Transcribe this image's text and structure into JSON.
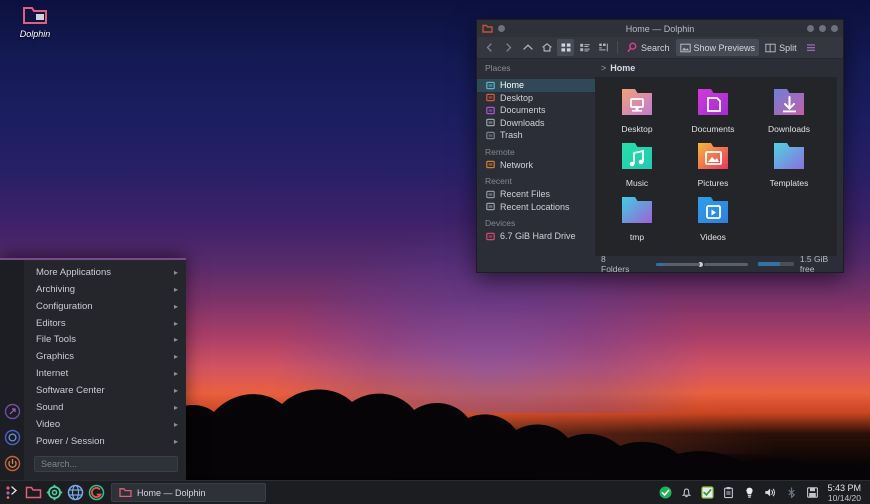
{
  "desktop": {
    "icon": {
      "label": "Dolphin",
      "icon": "folder-icon"
    }
  },
  "dolphin": {
    "titlebar": {
      "title": "Home — Dolphin",
      "app_icon": "folder-icon",
      "menu_dot": "window-menu-dot",
      "buttons": [
        "minimize-button",
        "maximize-button",
        "close-button"
      ]
    },
    "toolbar": {
      "back": "back-arrow-icon",
      "forward": "forward-arrow-icon",
      "up": "up-arrow-icon",
      "home": "home-icon",
      "view_icons": "view-icons-icon",
      "view_compact": "view-compact-icon",
      "view_details": "view-details-icon",
      "search_label": "Search",
      "search_icon": "search-icon",
      "previews_label": "Show Previews",
      "previews_icon": "image-preview-icon",
      "split_label": "Split",
      "split_icon": "split-view-icon",
      "hamburger": "hamburger-menu-icon"
    },
    "breadcrumb": {
      "separator": ">",
      "path": "Home"
    },
    "sidebar": {
      "groups": [
        {
          "title": "Places",
          "items": [
            {
              "label": "Home",
              "icon": "home-icon",
              "selected": true,
              "color": "#5fb3c8"
            },
            {
              "label": "Desktop",
              "icon": "desktop-icon",
              "selected": false,
              "color": "#e0553f"
            },
            {
              "label": "Documents",
              "icon": "documents-icon",
              "selected": false,
              "color": "#a855d8"
            },
            {
              "label": "Downloads",
              "icon": "downloads-icon",
              "selected": false,
              "color": "#9aa0aa"
            },
            {
              "label": "Trash",
              "icon": "trash-icon",
              "selected": false,
              "color": "#7c818b"
            }
          ]
        },
        {
          "title": "Remote",
          "items": [
            {
              "label": "Network",
              "icon": "network-icon",
              "selected": false,
              "color": "#d08030"
            }
          ]
        },
        {
          "title": "Recent",
          "items": [
            {
              "label": "Recent Files",
              "icon": "recent-files-icon",
              "selected": false,
              "color": "#8f93a0"
            },
            {
              "label": "Recent Locations",
              "icon": "recent-locations-icon",
              "selected": false,
              "color": "#9aa0aa"
            }
          ]
        },
        {
          "title": "Devices",
          "items": [
            {
              "label": "6.7 GiB Hard Drive",
              "icon": "hard-drive-icon",
              "selected": false,
              "color": "#d04a6e"
            }
          ]
        }
      ]
    },
    "files": [
      {
        "name": "Desktop",
        "icon": "folder-desktop-icon",
        "c1": "#f0a27a",
        "c2": "#c17bd0",
        "glyph": "monitor"
      },
      {
        "name": "Documents",
        "icon": "folder-documents-icon",
        "c1": "#d13ad8",
        "c2": "#a12fd0",
        "glyph": "page"
      },
      {
        "name": "Downloads",
        "icon": "folder-downloads-icon",
        "c1": "#6f7fd8",
        "c2": "#c25fa8",
        "glyph": "arrow-down"
      },
      {
        "name": "Music",
        "icon": "folder-music-icon",
        "c1": "#26e0a8",
        "c2": "#22c8b4",
        "glyph": "note"
      },
      {
        "name": "Pictures",
        "icon": "folder-pictures-icon",
        "c1": "#f5b83c",
        "c2": "#e8365f",
        "glyph": "image"
      },
      {
        "name": "Templates",
        "icon": "folder-templates-icon",
        "c1": "#4fd3e0",
        "c2": "#8a6fe0",
        "glyph": "none"
      },
      {
        "name": "tmp",
        "icon": "folder-tmp-icon",
        "c1": "#3ecfe0",
        "c2": "#a05fd8",
        "glyph": "none"
      },
      {
        "name": "Videos",
        "icon": "folder-videos-icon",
        "c1": "#2f9ee8",
        "c2": "#2f7fe0",
        "glyph": "video"
      }
    ],
    "statusbar": {
      "count": "8 Folders",
      "free_space": "1.5 GiB free",
      "zoom_percent": 20
    }
  },
  "appmenu": {
    "items": [
      {
        "label": "More Applications",
        "arrow": "▸"
      },
      {
        "label": "Archiving",
        "arrow": "▸"
      },
      {
        "label": "Configuration",
        "arrow": "▸"
      },
      {
        "label": "Editors",
        "arrow": "▸"
      },
      {
        "label": "File Tools",
        "arrow": "▸"
      },
      {
        "label": "Graphics",
        "arrow": "▸"
      },
      {
        "label": "Internet",
        "arrow": "▸"
      },
      {
        "label": "Software Center",
        "arrow": "▸"
      },
      {
        "label": "Sound",
        "arrow": "▸"
      },
      {
        "label": "Video",
        "arrow": "▸"
      },
      {
        "label": "Power / Session",
        "arrow": "▸"
      }
    ],
    "search_placeholder": "Search...",
    "strip_icons": [
      "run-command-icon",
      "session-icon",
      "power-icon"
    ]
  },
  "taskbar": {
    "launchers": [
      {
        "name": "application-menu-icon",
        "color": "#e05b73"
      },
      {
        "name": "file-manager-icon",
        "color": "#e0607a"
      },
      {
        "name": "settings-gear-icon",
        "color": "#4dd2a0"
      },
      {
        "name": "web-browser-icon",
        "color": "#7aa7e8"
      },
      {
        "name": "gimp-icon",
        "color": "#e05a3a"
      }
    ],
    "task": {
      "label": "Home — Dolphin",
      "icon": "folder-icon"
    },
    "tray": [
      {
        "name": "updates-ok-icon",
        "glyph": "✔",
        "color": "#21b35a"
      },
      {
        "name": "notifications-bell-icon",
        "glyph": "🔔",
        "color": "#cfd2d8"
      },
      {
        "name": "checkbox-icon",
        "glyph": "✔",
        "color": "#31c04f"
      },
      {
        "name": "clipboard-icon",
        "glyph": "📋",
        "color": "#c3c6cc"
      },
      {
        "name": "brightness-icon",
        "glyph": "💡",
        "color": "#d8dbe0"
      },
      {
        "name": "volume-icon",
        "glyph": "🔊",
        "color": "#d8dbe0"
      },
      {
        "name": "bluetooth-icon",
        "glyph": "✻",
        "color": "#6f7480"
      },
      {
        "name": "disk-icon",
        "glyph": "💾",
        "color": "#c3c6cc"
      }
    ],
    "clock": {
      "time": "5:43 PM",
      "date": "10/14/20"
    }
  },
  "colors": {
    "accent": "#7a4a8e",
    "selection": "#2f4a56",
    "window_bg": "#2b2e36",
    "view_bg": "#232529"
  }
}
